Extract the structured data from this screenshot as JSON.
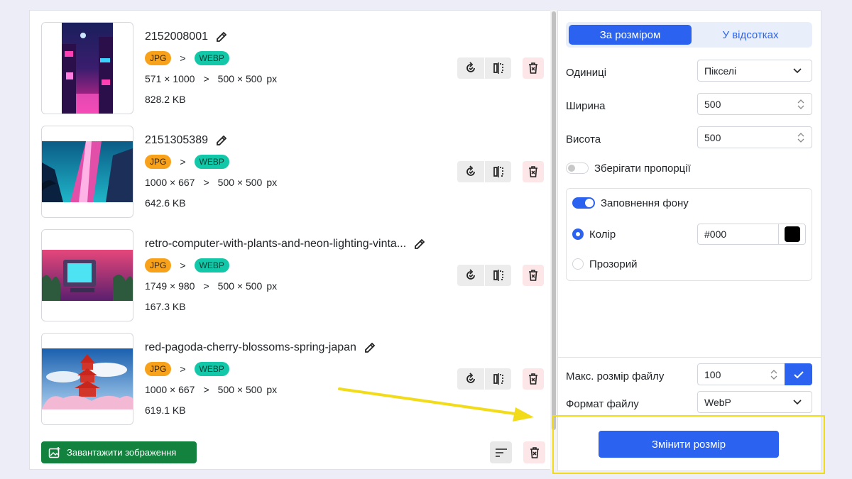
{
  "images": [
    {
      "name": "2152008001",
      "from": "JPG",
      "to": "WEBP",
      "orig_dims": "571 × 1000",
      "new_dims": "500 × 500",
      "unit": "px",
      "size": "828.2 KB",
      "sep": ">"
    },
    {
      "name": "2151305389",
      "from": "JPG",
      "to": "WEBP",
      "orig_dims": "1000 × 667",
      "new_dims": "500 × 500",
      "unit": "px",
      "size": "642.6 KB",
      "sep": ">"
    },
    {
      "name": "retro-computer-with-plants-and-neon-lighting-vinta...",
      "from": "JPG",
      "to": "WEBP",
      "orig_dims": "1749 × 980",
      "new_dims": "500 × 500",
      "unit": "px",
      "size": "167.3 KB",
      "sep": ">"
    },
    {
      "name": "red-pagoda-cherry-blossoms-spring-japan",
      "from": "JPG",
      "to": "WEBP",
      "orig_dims": "1000 × 667",
      "new_dims": "500 × 500",
      "unit": "px",
      "size": "619.1 KB",
      "sep": ">"
    }
  ],
  "footer": {
    "upload_label": "Завантажити зображення"
  },
  "settings": {
    "tabs": {
      "by_size": "За розміром",
      "by_percent": "У відсотках"
    },
    "units_label": "Одиниці",
    "units_value": "Пікселі",
    "width_label": "Ширина",
    "width_value": "500",
    "height_label": "Висота",
    "height_value": "500",
    "keep_ratio_label": "Зберігати пропорції",
    "fill_bg_label": "Заповнення фону",
    "color_label": "Колір",
    "color_value": "#000",
    "transparent_label": "Прозорий",
    "max_size_label": "Макс. розмір файлу",
    "max_size_value": "100",
    "format_label": "Формат файлу",
    "format_value": "WebP",
    "resize_button": "Змінити розмір"
  },
  "colors": {
    "primary": "#2b63f0",
    "upload": "#12823e",
    "jpg_badge": "#f8a21b",
    "webp_badge": "#12c8a8",
    "highlight": "#f2dc1a"
  }
}
